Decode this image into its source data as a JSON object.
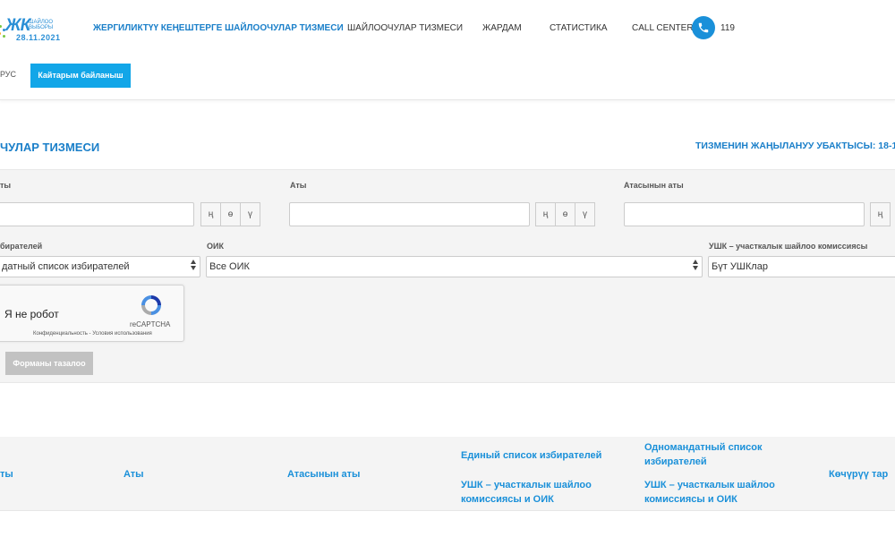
{
  "header": {
    "logo": {
      "brand": "ЖК",
      "subtitle_line1": "ШАЙЛОО",
      "subtitle_line2": "ВЫБОРЫ",
      "date": "28.11.2021"
    },
    "nav": [
      {
        "label": "Жергиликтүү кеңештерге шайлоочулар тизмеси",
        "active": true
      },
      {
        "label": "Шайлоочулар тизмеси",
        "active": false
      },
      {
        "label": "Жардам",
        "active": false
      },
      {
        "label": "Статистика",
        "active": false
      },
      {
        "label": "Call center",
        "active": false
      }
    ],
    "phone_number": "119",
    "lang": "РУС",
    "feedback_label": "Кайтарым байланыш"
  },
  "page": {
    "title": "ЧУЛАР ТИЗМЕСИ",
    "update_label": "ТИЗМЕНИН ЖАҢЫЛАНУУ УБАКТЫСЫ: 18-1"
  },
  "filters": {
    "surname_label": "ты",
    "name_label": "Аты",
    "patronymic_label": "Атасынын аты",
    "letters": [
      "ң",
      "ө",
      "ү"
    ],
    "letters_partial": [
      "ң"
    ],
    "list_label": "бирателей",
    "list_value": "датный список избирателей",
    "oik_label": "ОИК",
    "oik_value": "Все ОИК",
    "ushk_label": "УШК – участкалык шайлоо комиссиясы",
    "ushk_value": "Бүт УШКлар",
    "captcha_text": "Я не робот",
    "captcha_brand": "reCAPTCHA",
    "captcha_links": "Конфиденциальность - Условия использования",
    "clear_label": "Форманы тазалоо"
  },
  "table": {
    "columns": [
      "ты",
      "Аты",
      "Атасынын аты",
      "Единый список избирателей",
      "УШК – участкалык шайлоо комиссиясы и ОИК",
      "Одномандатный список избирателей",
      "УШК – участкалык шайлоо комиссиясы и ОИК",
      "Көчүрүү тар"
    ]
  },
  "colors": {
    "accent": "#1a7fc9",
    "button": "#12a6e8",
    "panel": "#f4f4f4"
  }
}
